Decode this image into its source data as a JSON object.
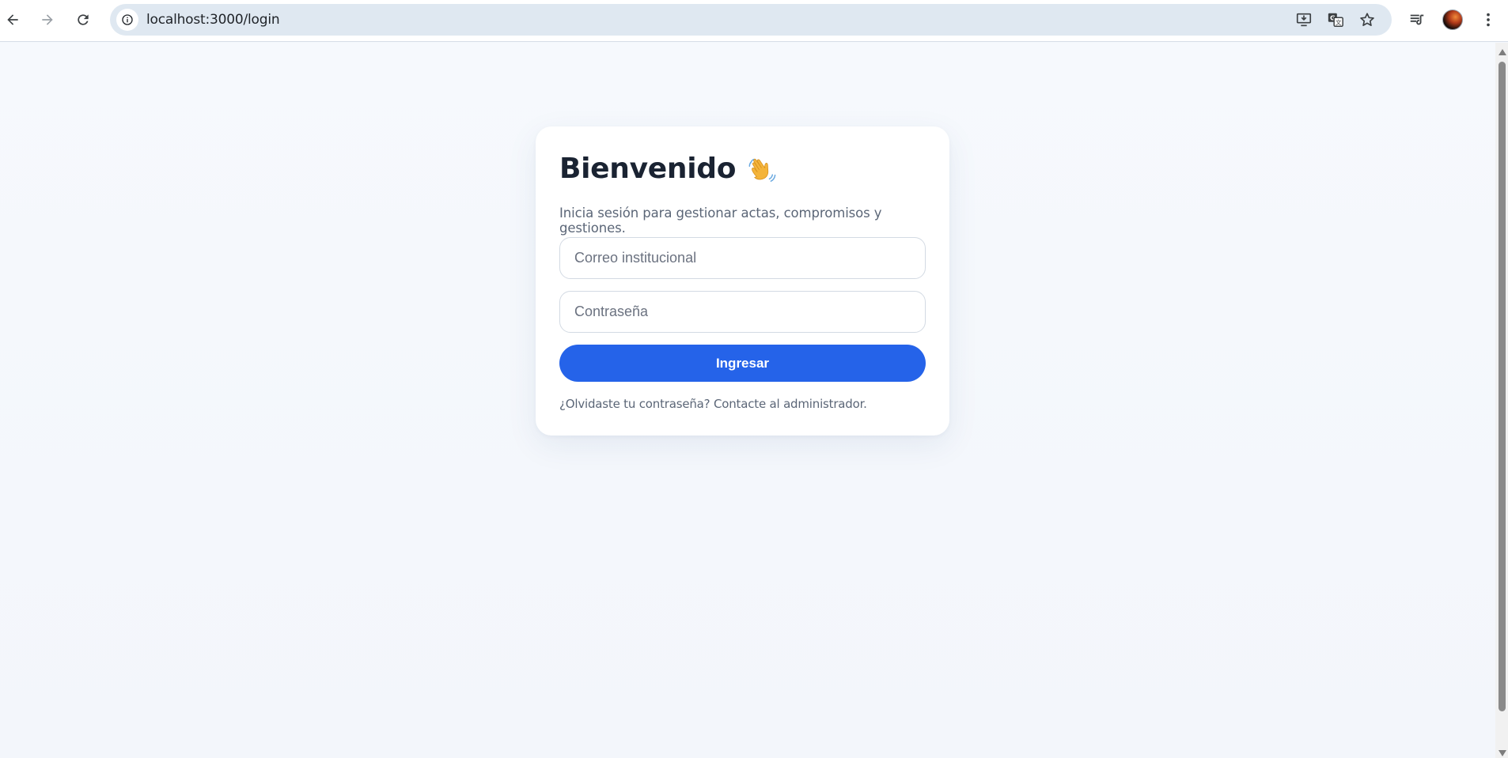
{
  "browser": {
    "url": "localhost:3000/login",
    "icons": {
      "back": "arrow-left-icon",
      "forward": "arrow-right-icon",
      "reload": "reload-icon",
      "site_info": "info-icon",
      "install": "install-app-icon",
      "translate": "translate-icon",
      "bookmark": "star-icon",
      "media": "media-controls-icon",
      "menu": "kebab-menu-icon"
    }
  },
  "login": {
    "title": "Bienvenido",
    "subtitle": "Inicia sesión para gestionar actas, compromisos y gestiones.",
    "email": {
      "value": "",
      "placeholder": "Correo institucional"
    },
    "password": {
      "value": "",
      "placeholder": "Contraseña"
    },
    "submit_label": "Ingresar",
    "forgot_text": "¿Olvidaste tu contraseña? Contacte al administrador."
  },
  "colors": {
    "primary": "#2563e9",
    "title": "#1a2332",
    "muted": "#5b6677",
    "background": "#f4f7fc"
  }
}
